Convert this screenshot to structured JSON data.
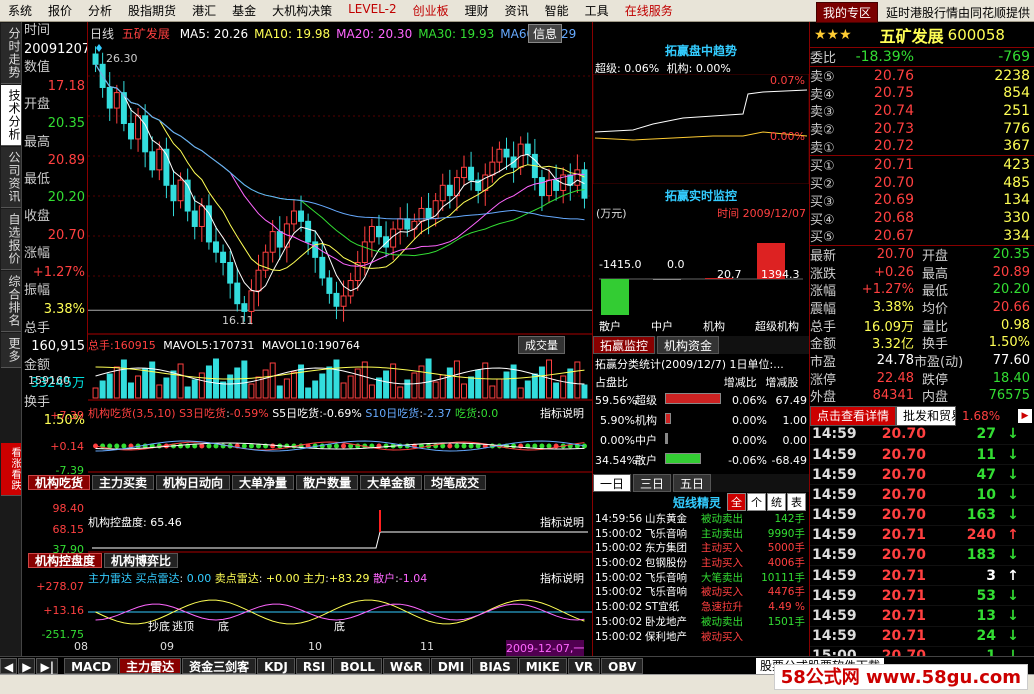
{
  "menu": [
    "系统",
    "报价",
    "分析",
    "股指期货",
    "港汇",
    "基金",
    "大机构决策",
    "LEVEL-2",
    "创业板",
    "理财",
    "资讯",
    "智能",
    "工具",
    "在线服务"
  ],
  "menu_red": [
    "LEVEL-2",
    "创业板",
    "在线服务"
  ],
  "my_zone": "我的专区",
  "ticker_msg": "延时港股行情由同花顺提供",
  "left_tabs": [
    "分时走势",
    "技术分析",
    "公司资讯",
    "自选报价",
    "综合排名",
    "更多"
  ],
  "left_bottom_tab": "看涨看跌",
  "info": {
    "rows": [
      {
        "label": "时间",
        "value": "",
        "cls": "lbl"
      },
      {
        "label": "",
        "value": "20091207",
        "cls": "white"
      },
      {
        "label": "数值",
        "value": "",
        "cls": "lbl"
      },
      {
        "label": "",
        "value": "17.18",
        "cls": "red"
      },
      {
        "label": "开盘",
        "value": "",
        "cls": "lbl"
      },
      {
        "label": "",
        "value": "20.35",
        "cls": "green"
      },
      {
        "label": "最高",
        "value": "",
        "cls": "lbl"
      },
      {
        "label": "",
        "value": "20.89",
        "cls": "red"
      },
      {
        "label": "最低",
        "value": "",
        "cls": "lbl"
      },
      {
        "label": "",
        "value": "20.20",
        "cls": "green"
      },
      {
        "label": "收盘",
        "value": "",
        "cls": "lbl"
      },
      {
        "label": "",
        "value": "20.70",
        "cls": "red"
      },
      {
        "label": "涨幅",
        "value": "",
        "cls": "lbl"
      },
      {
        "label": "",
        "value": "+1.27%",
        "cls": "red"
      },
      {
        "label": "振幅",
        "value": "",
        "cls": "lbl"
      },
      {
        "label": "",
        "value": "3.38%",
        "cls": "yellow"
      },
      {
        "label": "总手",
        "value": "",
        "cls": "lbl"
      },
      {
        "label": "",
        "value": "160,915",
        "cls": "white"
      },
      {
        "label": "金额",
        "value": "",
        "cls": "lbl"
      },
      {
        "label": "",
        "value": "33245万",
        "cls": "cyan"
      },
      {
        "label": "换手",
        "value": "",
        "cls": "lbl"
      },
      {
        "label": "",
        "value": "1.50%",
        "cls": "yellow"
      }
    ]
  },
  "kline": {
    "period": "日线",
    "name": "五矿发展",
    "ma": [
      {
        "label": "MA5: 20.26",
        "color": "#ffffff"
      },
      {
        "label": "MA10: 19.98",
        "color": "#ffff55"
      },
      {
        "label": "MA20: 20.30",
        "color": "#ff66ff"
      },
      {
        "label": "MA30: 19.93",
        "color": "#33dd33"
      },
      {
        "label": "MA60: 19.29",
        "color": "#66aaff"
      }
    ],
    "info_btn": "信息",
    "high_label": "26.30",
    "low_label": "16.11"
  },
  "chart_data": {
    "type": "candlestick",
    "title": "五矿发展 日线",
    "high_marker": 26.3,
    "low_marker": 16.11,
    "closes": [
      25.9,
      25.0,
      24.2,
      24.8,
      23.6,
      23.0,
      23.9,
      22.5,
      21.8,
      22.6,
      21.2,
      20.6,
      21.4,
      20.2,
      19.6,
      20.4,
      19.0,
      18.6,
      18.2,
      17.4,
      16.6,
      16.3,
      17.1,
      17.9,
      18.6,
      19.4,
      18.8,
      19.7,
      20.2,
      19.8,
      19.0,
      18.4,
      17.6,
      17.0,
      16.5,
      16.9,
      17.5,
      18.2,
      19.0,
      19.6,
      19.2,
      18.8,
      19.5,
      19.9,
      19.5,
      19.8,
      20.3,
      19.9,
      20.6,
      21.2,
      20.8,
      21.5,
      21.9,
      21.4,
      21.0,
      21.6,
      22.1,
      22.6,
      22.3,
      21.9,
      22.8,
      22.4,
      21.5,
      20.8,
      21.4,
      21.0,
      21.6,
      21.2,
      21.8,
      20.7
    ],
    "volume": {
      "label": "总手",
      "total": "160915",
      "mavol5_label": "MAVOL5",
      "mavol5": "170731",
      "mavol10_label": "MAVOL10",
      "mavol10": "190764",
      "scale": "159160",
      "button": "成交量"
    },
    "jgcd": {
      "label": "机构吃货",
      "params": "(3,5,10)",
      "s3_label": "S3日吃货",
      "s3": "-0.59%",
      "s5_label": "S5日吃货",
      "s5": "-0.69%",
      "s10_label": "S10日吃货",
      "s10": "-2.37",
      "chi_label": "吃货",
      "chi": "0.0",
      "ymax": "+7.39",
      "ymid": "+0.14",
      "ymin": "-7.39",
      "explain": "指标说明"
    },
    "kpd": {
      "label": "机构控盘度",
      "value": "65.46",
      "ymax": "98.40",
      "ymid": "68.15",
      "ymin": "37.90",
      "explain": "指标说明"
    },
    "zlld": {
      "label": "主力雷达",
      "buy_label": "买点雷达",
      "buy": "0.00",
      "sell_label": "卖点雷达",
      "sell": "+0.00",
      "main_label": "主力",
      "main": "+83.29",
      "retail_label": "散户",
      "retail": "-1.04",
      "ymax": "+278.07",
      "ymid": "+13.16",
      "ymin": "-251.75",
      "explain": "指标说明",
      "marks": [
        "抄底",
        "逃顶",
        "底",
        "底"
      ]
    },
    "x_ticks": [
      "08",
      "09",
      "10",
      "11",
      "2009-12-07,一"
    ]
  },
  "ind_tabs1": [
    "机构吃货",
    "主力买卖",
    "机构日动向",
    "大单净量",
    "散户数量",
    "大单金额",
    "均笔成交"
  ],
  "ind_tabs2": [
    "机构控盘度",
    "机构博弈比"
  ],
  "mid": {
    "trend_title": "拓赢盘中趋势",
    "trend_super": "超级: 0.06%",
    "trend_inst": "机构: 0.00%",
    "trend_y1": "0.07%",
    "trend_y2": "0.00%",
    "monitor_title": "拓赢实时监控",
    "unit": "(万元)",
    "time_label": "时间",
    "time_val": "2009/12/07",
    "bars": [
      {
        "label": "散户",
        "value": "-1415.0",
        "color": "#33cc33"
      },
      {
        "label": "中户",
        "value": "0.0",
        "color": "#888"
      },
      {
        "label": "机构",
        "value": "20.7",
        "color": "#cc2222"
      },
      {
        "label": "超级机构",
        "value": "1394.3",
        "color": "#dd2222"
      }
    ],
    "tabs": [
      "拓赢监控",
      "机构资金"
    ],
    "stat_title": "拓赢分类统计",
    "stat_date": "(2009/12/7)",
    "stat_unit": "1日单位:...",
    "stat_head": [
      "占盘比",
      "增减比",
      "增减股"
    ],
    "stat_rows": [
      {
        "pct": "59.56%",
        "name": "超级",
        "bar": "#cc2222",
        "w": 56,
        "chg": "0.06%",
        "sh": "67.49"
      },
      {
        "pct": "5.90%",
        "name": "机构",
        "bar": "#cc2222",
        "w": 6,
        "chg": "0.00%",
        "sh": "1.00"
      },
      {
        "pct": "0.00%",
        "name": "中户",
        "bar": "#888",
        "w": 1,
        "chg": "0.00%",
        "sh": "0.00"
      },
      {
        "pct": "34.54%",
        "name": "散户",
        "bar": "#33cc33",
        "w": 36,
        "chg": "-0.06%",
        "sh": "-68.49"
      }
    ],
    "day_tabs": [
      "一日",
      "三日",
      "五日"
    ],
    "elf_title": "短线精灵",
    "elf_tabs": [
      "全",
      "个",
      "统",
      "表"
    ],
    "elf": [
      {
        "t": "14:59:56",
        "s": "山东黄金",
        "e": "被动卖出",
        "v": "142手",
        "c": "#33dd33"
      },
      {
        "t": "15:00:02",
        "s": "飞乐音响",
        "e": "主动卖出",
        "v": "9990手",
        "c": "#33dd33"
      },
      {
        "t": "15:00:02",
        "s": "东方集团",
        "e": "主动买入",
        "v": "5000手",
        "c": "#ff4040"
      },
      {
        "t": "15:00:02",
        "s": "包钢股份",
        "e": "主动买入",
        "v": "4006手",
        "c": "#ff4040"
      },
      {
        "t": "15:00:02",
        "s": "飞乐音响",
        "e": "大笔卖出",
        "v": "10111手",
        "c": "#33dd33"
      },
      {
        "t": "15:00:02",
        "s": "飞乐音响",
        "e": "被动买入",
        "v": "4476手",
        "c": "#ff4040"
      },
      {
        "t": "15:00:02",
        "s": "ST宜纸",
        "e": "急速拉升",
        "v": "4.49 %",
        "c": "#ff4040"
      },
      {
        "t": "15:00:02",
        "s": "卧龙地产",
        "e": "被动卖出",
        "v": "1501手",
        "c": "#33dd33"
      },
      {
        "t": "15:00:02",
        "s": "保利地产",
        "e": "被动买入",
        "v": "",
        "c": "#ff4040"
      }
    ]
  },
  "right": {
    "stars": "★★★",
    "name": "五矿发展",
    "code": "600058",
    "weibi_label": "委比",
    "weibi": "-18.39%",
    "weicha": "-769",
    "asks": [
      {
        "k": "卖⑤",
        "p": "20.76",
        "v": "2238"
      },
      {
        "k": "卖④",
        "p": "20.75",
        "v": "854"
      },
      {
        "k": "卖③",
        "p": "20.74",
        "v": "251"
      },
      {
        "k": "卖②",
        "p": "20.73",
        "v": "776"
      },
      {
        "k": "卖①",
        "p": "20.72",
        "v": "367"
      }
    ],
    "bids": [
      {
        "k": "买①",
        "p": "20.71",
        "v": "423"
      },
      {
        "k": "买②",
        "p": "20.70",
        "v": "485"
      },
      {
        "k": "买③",
        "p": "20.69",
        "v": "134"
      },
      {
        "k": "买④",
        "p": "20.68",
        "v": "330"
      },
      {
        "k": "买⑤",
        "p": "20.67",
        "v": "334"
      }
    ],
    "quote": [
      {
        "a": "最新",
        "b": "20.70",
        "bc": "red",
        "c": "开盘",
        "d": "20.35",
        "dc": "green"
      },
      {
        "a": "涨跌",
        "b": "+0.26",
        "bc": "red",
        "c": "最高",
        "d": "20.89",
        "dc": "red"
      },
      {
        "a": "涨幅",
        "b": "+1.27%",
        "bc": "red",
        "c": "最低",
        "d": "20.20",
        "dc": "green"
      },
      {
        "a": "震幅",
        "b": "3.38%",
        "bc": "yellow",
        "c": "均价",
        "d": "20.66",
        "dc": "red"
      },
      {
        "a": "总手",
        "b": "16.09万",
        "bc": "yellow",
        "c": "量比",
        "d": "0.98",
        "dc": "yellow"
      },
      {
        "a": "金额",
        "b": "3.32亿",
        "bc": "yellow",
        "c": "换手",
        "d": "1.50%",
        "dc": "yellow"
      },
      {
        "a": "市盈",
        "b": "24.78",
        "bc": "white",
        "c": "市盈(动)",
        "d": "77.60",
        "dc": "white"
      },
      {
        "a": "涨停",
        "b": "22.48",
        "bc": "red",
        "c": "跌停",
        "d": "18.40",
        "dc": "green"
      },
      {
        "a": "外盘",
        "b": "84341",
        "bc": "red",
        "c": "内盘",
        "d": "76575",
        "dc": "green"
      }
    ],
    "detail_btn": "点击查看详情",
    "tab2": "批发和贸易",
    "tab2_pct": "1.68%",
    "ticks": [
      {
        "t": "14:59",
        "p": "20.70",
        "v": "27",
        "vc": "#33dd33",
        "ar": "↓",
        "ac": "#33dd33"
      },
      {
        "t": "14:59",
        "p": "20.70",
        "v": "11",
        "vc": "#33dd33",
        "ar": "↓",
        "ac": "#33dd33"
      },
      {
        "t": "14:59",
        "p": "20.70",
        "v": "47",
        "vc": "#33dd33",
        "ar": "↓",
        "ac": "#33dd33"
      },
      {
        "t": "14:59",
        "p": "20.70",
        "v": "10",
        "vc": "#33dd33",
        "ar": "↓",
        "ac": "#33dd33"
      },
      {
        "t": "14:59",
        "p": "20.70",
        "v": "163",
        "vc": "#33dd33",
        "ar": "↓",
        "ac": "#33dd33"
      },
      {
        "t": "14:59",
        "p": "20.71",
        "v": "240",
        "vc": "#ff4040",
        "ar": "↑",
        "ac": "#ff4040"
      },
      {
        "t": "14:59",
        "p": "20.70",
        "v": "183",
        "vc": "#33dd33",
        "ar": "↓",
        "ac": "#33dd33"
      },
      {
        "t": "14:59",
        "p": "20.71",
        "v": "3",
        "vc": "#ffffff",
        "ar": "↑",
        "ac": "#ffffff"
      },
      {
        "t": "14:59",
        "p": "20.71",
        "v": "53",
        "vc": "#33dd33",
        "ar": "↓",
        "ac": "#33dd33"
      },
      {
        "t": "14:59",
        "p": "20.71",
        "v": "13",
        "vc": "#33dd33",
        "ar": "↓",
        "ac": "#33dd33"
      },
      {
        "t": "14:59",
        "p": "20.71",
        "v": "24",
        "vc": "#33dd33",
        "ar": "↓",
        "ac": "#33dd33"
      },
      {
        "t": "15:00",
        "p": "20.70",
        "v": "1",
        "vc": "#33dd33",
        "ar": "↓",
        "ac": "#33dd33"
      }
    ]
  },
  "bottom_tabs": [
    "MACD",
    "主力雷达",
    "资金三剑客",
    "KDJ",
    "RSI",
    "BOLL",
    "W&R",
    "DMI",
    "BIAS",
    "MIKE",
    "VR",
    "OBV"
  ],
  "bottom_sel": "主力雷达",
  "ad": "股票公式股票软件下载",
  "watermark": "58公式网 www.58gu.com"
}
